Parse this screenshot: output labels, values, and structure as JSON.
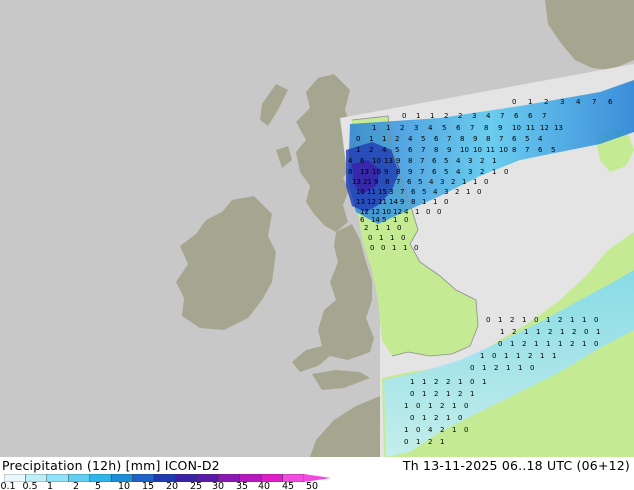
{
  "map": {
    "colors": {
      "sea": "#c8c8c8",
      "land_outside_domain": "#a6a690",
      "land_inside_domain": "#c4eb94",
      "domain_sea": "#e4e4e4",
      "coast": "#8c8c8c"
    },
    "numbers": [
      {
        "row": 0,
        "values": [
          "0",
          "1",
          "2",
          "3",
          "4",
          "7",
          "6"
        ]
      },
      {
        "row": 1,
        "values": [
          "0",
          "1",
          "1",
          "2",
          "2",
          "3",
          "4",
          "7",
          "6",
          "6",
          "7"
        ]
      },
      {
        "row": 2,
        "values": [
          "1",
          "1",
          "2",
          "3",
          "4",
          "5",
          "6",
          "7",
          "8",
          "9",
          "10",
          "11",
          "12",
          "13"
        ]
      },
      {
        "row": 3,
        "values": [
          "0",
          "1",
          "1",
          "2",
          "4",
          "5",
          "6",
          "7",
          "8",
          "9",
          "8",
          "7",
          "6",
          "5",
          "4"
        ]
      },
      {
        "row": 4,
        "values": [
          "1",
          "2",
          "4",
          "5",
          "6",
          "7",
          "8",
          "9",
          "10",
          "10",
          "11",
          "10",
          "8",
          "7",
          "6",
          "5"
        ]
      },
      {
        "row": 5,
        "values": [
          "4",
          "6",
          "10",
          "13",
          "9",
          "8",
          "7",
          "6",
          "5",
          "4",
          "3",
          "2",
          "1"
        ]
      },
      {
        "row": 6,
        "values": [
          "8",
          "13",
          "10",
          "9",
          "8",
          "9",
          "7",
          "6",
          "5",
          "4",
          "3",
          "2",
          "1",
          "0"
        ]
      },
      {
        "row": 7,
        "values": [
          "13",
          "21",
          "9",
          "8",
          "7",
          "6",
          "5",
          "4",
          "3",
          "2",
          "1",
          "1",
          "0"
        ]
      },
      {
        "row": 8,
        "values": [
          "10",
          "11",
          "15",
          "3",
          "7",
          "6",
          "5",
          "4",
          "3",
          "2",
          "1",
          "0"
        ]
      },
      {
        "row": 9,
        "values": [
          "13",
          "12",
          "11",
          "14",
          "9",
          "8",
          "1",
          "1",
          "0"
        ]
      },
      {
        "row": 10,
        "values": [
          "12",
          "12",
          "10",
          "12",
          "4",
          "1",
          "0",
          "0"
        ]
      },
      {
        "row": 11,
        "values": [
          "6",
          "14",
          "5",
          "1",
          "0"
        ]
      },
      {
        "row": 12,
        "values": [
          "2",
          "1",
          "1",
          "0"
        ]
      },
      {
        "row": 13,
        "values": [
          "0",
          "1",
          "1",
          "0"
        ]
      },
      {
        "row": 14,
        "values": [
          "0",
          "0",
          "1",
          "1",
          "0"
        ]
      },
      {
        "row": 15,
        "values": [
          "0",
          "1",
          "2",
          "1",
          "0",
          "1",
          "2",
          "1",
          "1",
          "0"
        ]
      },
      {
        "row": 16,
        "values": [
          "1",
          "2",
          "1",
          "1",
          "2",
          "1",
          "2",
          "0",
          "1"
        ]
      },
      {
        "row": 17,
        "values": [
          "0",
          "1",
          "2",
          "1",
          "1",
          "1",
          "2",
          "1",
          "0"
        ]
      },
      {
        "row": 18,
        "values": [
          "1",
          "0",
          "1",
          "1",
          "2",
          "1",
          "1"
        ]
      },
      {
        "row": 19,
        "values": [
          "0",
          "1",
          "2",
          "1",
          "1",
          "0"
        ]
      },
      {
        "row": 20,
        "values": [
          "1",
          "1",
          "2",
          "2",
          "1",
          "0",
          "1"
        ]
      },
      {
        "row": 21,
        "values": [
          "0",
          "1",
          "2",
          "1",
          "2",
          "1"
        ]
      },
      {
        "row": 22,
        "values": [
          "1",
          "0",
          "1",
          "2",
          "1",
          "0"
        ]
      },
      {
        "row": 23,
        "values": [
          "0",
          "1",
          "2",
          "1",
          "0"
        ]
      },
      {
        "row": 24,
        "values": [
          "1",
          "0",
          "4",
          "2",
          "1",
          "0"
        ]
      },
      {
        "row": 25,
        "values": [
          "0",
          "1",
          "2",
          "1"
        ]
      }
    ]
  },
  "footer": {
    "title": "Precipitation (12h) [mm] ICON-D2",
    "run": "Th 13-11-2025 06..18 UTC (06+12)"
  },
  "legend": {
    "ticks": [
      "0.1",
      "0.5",
      "1",
      "2",
      "5",
      "10",
      "15",
      "20",
      "25",
      "30",
      "35",
      "40",
      "45",
      "50"
    ],
    "colors": [
      "#e8f8fc",
      "#bdeefa",
      "#8fe2f7",
      "#5fd0f2",
      "#2eb6ea",
      "#1d8fd9",
      "#1e62c8",
      "#1f3bb3",
      "#3a22a6",
      "#5a1aa8",
      "#8a19b4",
      "#b818c0",
      "#e01ec8",
      "#f04de0"
    ]
  }
}
